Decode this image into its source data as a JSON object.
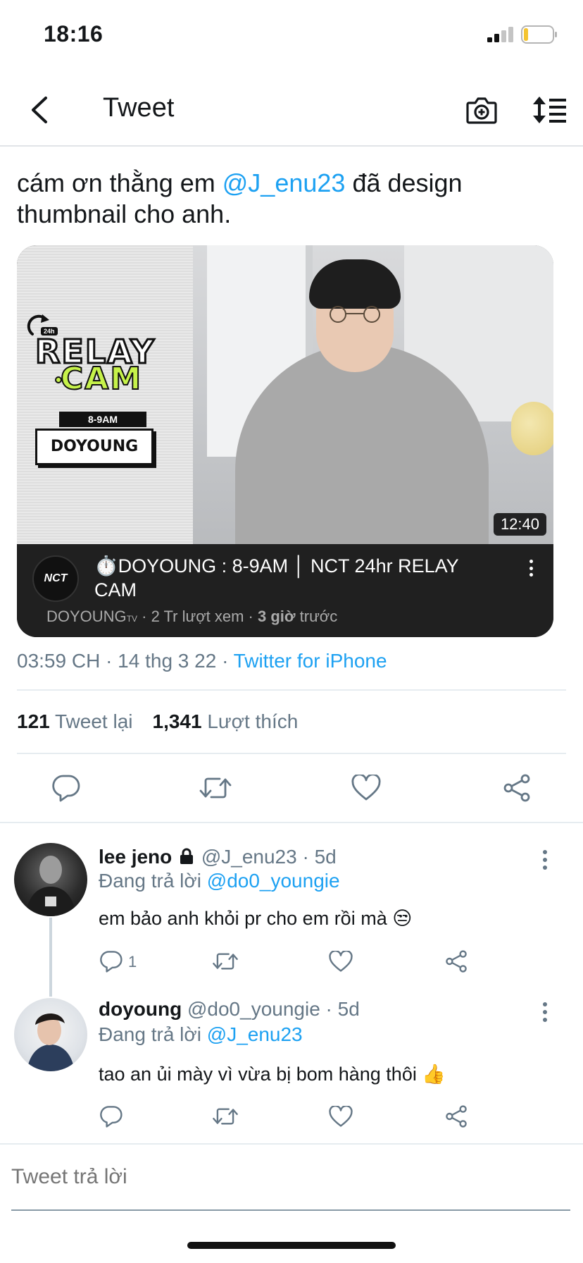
{
  "status": {
    "time": "18:16"
  },
  "nav": {
    "title": "Tweet"
  },
  "tweet": {
    "text_before": "cám ơn thằng em ",
    "mention": "@J_enu23",
    "text_after": " đã design thumbnail cho anh.",
    "timestamp": "03:59 CH · 14 thg 3 22 · ",
    "source": "Twitter for iPhone",
    "retweets": "121",
    "retweets_label": "Tweet lại",
    "likes": "1,341",
    "likes_label": "Lượt thích"
  },
  "video": {
    "thumbnail_tag": "24h",
    "thumbnail_word1": "RELAY",
    "thumbnail_word2": "CAM",
    "thumbnail_time": "8-9AM",
    "thumbnail_name": "DOYOUNG",
    "duration": "12:40",
    "channel_logo": "NCT",
    "title": "⏱️DOYOUNG : 8-9AM │ NCT 24hr RELAY CAM",
    "channel": "DOYOUNG",
    "channel_suffix": "TV",
    "views": " · 2 Tr lượt xem · ",
    "time_bold": "3 giờ",
    "time_rest": " trước"
  },
  "replies": [
    {
      "name": "lee jeno",
      "handle": " @J_enu23 · 5d",
      "replying_label": "Đang trả lời ",
      "replying_to": "@do0_youngie",
      "text": "em bảo anh khỏi pr cho em rồi mà 😒",
      "reply_count": "1"
    },
    {
      "name": "doyoung",
      "handle": " @do0_youngie · 5d",
      "replying_label": "Đang trả lời ",
      "replying_to": "@J_enu23",
      "text": "tao an ủi mày vì vừa bị bom hàng thôi 👍",
      "reply_count": ""
    }
  ],
  "compose": {
    "placeholder": "Tweet trả lời"
  },
  "icons": {
    "back": "chevron-left-icon",
    "camera": "camera-plus-icon",
    "sort": "sort-icon",
    "reply": "reply-icon",
    "retweet": "retweet-icon",
    "like": "heart-icon",
    "share": "share-icon"
  },
  "colors": {
    "accent": "#1da1f2",
    "muted": "#657786",
    "text": "#14171a"
  }
}
